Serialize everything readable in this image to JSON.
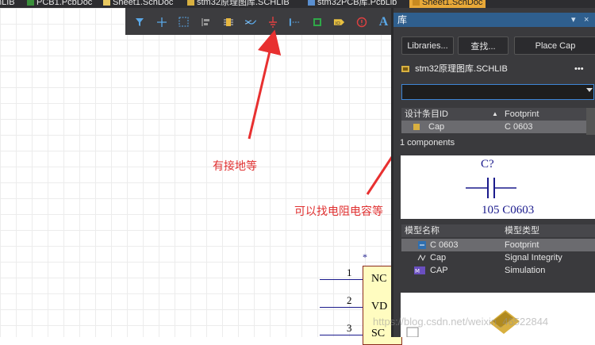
{
  "tabs": [
    {
      "label": "nLIB",
      "icon": "schlib-icon",
      "active": false
    },
    {
      "label": "PCB1.PcbDoc",
      "icon": "pcb-doc-icon",
      "active": false
    },
    {
      "label": "Sheet1.SchDoc",
      "icon": "sch-doc-icon",
      "active": false
    },
    {
      "label": "stm32原理图库.SCHLIB",
      "icon": "schlib-icon",
      "active": false
    },
    {
      "label": "stm32PCB库.PcbLib",
      "icon": "pcblib-icon",
      "active": false
    },
    {
      "label": "Sheet1.SchDoc",
      "icon": "sch-doc-icon",
      "active": true
    }
  ],
  "toolbar": {
    "text_tool": "A"
  },
  "annotations": {
    "ground": "有接地等",
    "resistor_cap": "可以找电阻电容等"
  },
  "schematic": {
    "star": "*",
    "pins": [
      {
        "num": "1",
        "label": "NC"
      },
      {
        "num": "2",
        "label": "VD"
      },
      {
        "num": "3",
        "label": "SC"
      }
    ]
  },
  "panel": {
    "title": "库",
    "header_controls": {
      "pin": "▾",
      "close": "×"
    },
    "buttons": {
      "libraries": "Libraries...",
      "search": "查找...",
      "place": "Place Cap"
    },
    "library_selected": "stm32原理图库.SCHLIB",
    "library_menu": "•••",
    "search_value": "",
    "component_table": {
      "headers": [
        "设计条目ID",
        "Footprint"
      ],
      "rows": [
        {
          "id": "Cap",
          "footprint": "C 0603",
          "selected": true
        }
      ]
    },
    "component_count": "1 components",
    "preview": {
      "designator": "C?",
      "value": "105 C0603"
    },
    "model_table": {
      "headers": [
        "模型名称",
        "模型类型"
      ],
      "rows": [
        {
          "name": "C 0603",
          "type": "Footprint",
          "selected": true,
          "icon": "footprint-model-icon"
        },
        {
          "name": "Cap",
          "type": "Signal Integrity",
          "selected": false,
          "icon": "signal-integrity-icon"
        },
        {
          "name": "CAP",
          "type": "Simulation",
          "selected": false,
          "icon": "simulation-icon"
        }
      ]
    }
  },
  "watermark": "https://blog.csdn.net/weixin_46522844"
}
